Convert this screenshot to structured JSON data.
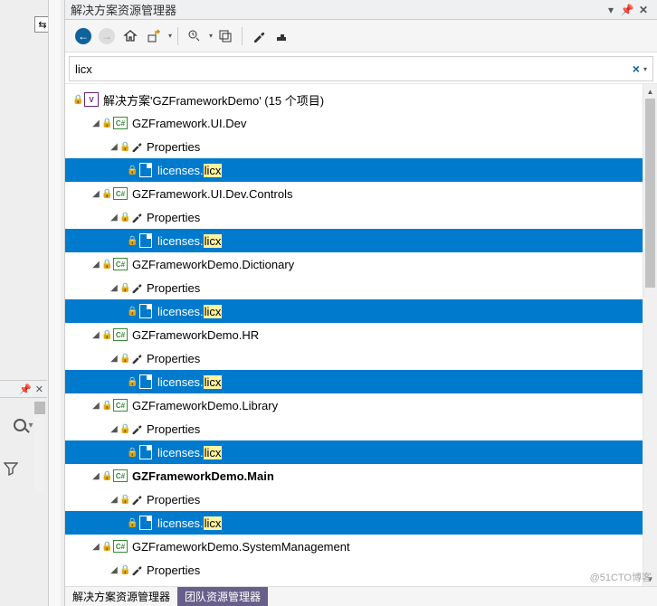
{
  "panel": {
    "title": "解决方案资源管理器"
  },
  "toolbar": {
    "back": "back",
    "forward": "forward",
    "home": "home",
    "sync": "sync-with-active-document",
    "refresh": "refresh-pending",
    "collapse": "collapse-all",
    "properties": "properties",
    "preview": "show-all-files"
  },
  "search": {
    "value": "licx"
  },
  "solution": {
    "label_prefix": "解决方案'GZFrameworkDemo' (",
    "count_text": "15 个项目",
    "label_suffix": ")"
  },
  "nodes": {
    "properties_label": "Properties",
    "file_prefix": "licenses.",
    "file_hl": "licx",
    "p1": "GZFramework.UI.Dev",
    "p2": "GZFramework.UI.Dev.Controls",
    "p3": "GZFrameworkDemo.Dictionary",
    "p4": "GZFrameworkDemo.HR",
    "p5": "GZFrameworkDemo.Library",
    "p6": "GZFrameworkDemo.Main",
    "p7": "GZFrameworkDemo.SystemManagement"
  },
  "tabs": {
    "active": "解决方案资源管理器",
    "inactive": "团队资源管理器"
  },
  "side": {
    "pin": "📌",
    "close": "✕"
  },
  "watermark": "@51CTO博客"
}
